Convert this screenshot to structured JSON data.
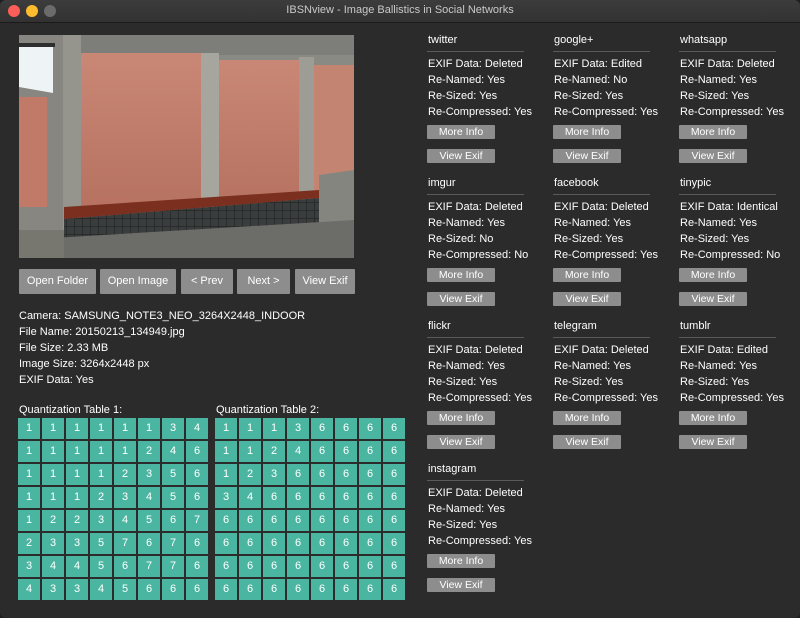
{
  "window": {
    "title": "IBSNview - Image Ballistics in Social Networks"
  },
  "toolbar": {
    "open_folder": "Open Folder",
    "open_image": "Open Image",
    "prev": "< Prev",
    "next": "Next >",
    "view_exif": "View Exif"
  },
  "info": {
    "camera": "Camera: SAMSUNG_NOTE3_NEO_3264X2448_INDOOR",
    "file_name": "File Name: 20150213_134949.jpg",
    "file_size": "File Size: 2.33 MB",
    "image_size": "Image Size: 3264x2448 px",
    "exif_data": "EXIF Data: Yes"
  },
  "quant": {
    "table1": {
      "label": "Quantization Table 1:",
      "rows": [
        [
          1,
          1,
          1,
          1,
          1,
          1,
          3,
          4
        ],
        [
          1,
          1,
          1,
          1,
          1,
          2,
          4,
          6
        ],
        [
          1,
          1,
          1,
          1,
          2,
          3,
          5,
          6
        ],
        [
          1,
          1,
          1,
          2,
          3,
          4,
          5,
          6
        ],
        [
          1,
          2,
          2,
          3,
          4,
          5,
          6,
          7
        ],
        [
          2,
          3,
          3,
          5,
          7,
          6,
          7,
          6
        ],
        [
          3,
          4,
          4,
          5,
          6,
          7,
          7,
          6
        ],
        [
          4,
          3,
          3,
          4,
          5,
          6,
          6,
          6
        ]
      ]
    },
    "table2": {
      "label": "Quantization Table 2:",
      "rows": [
        [
          1,
          1,
          1,
          3,
          6,
          6,
          6,
          6
        ],
        [
          1,
          1,
          2,
          4,
          6,
          6,
          6,
          6
        ],
        [
          1,
          2,
          3,
          6,
          6,
          6,
          6,
          6
        ],
        [
          3,
          4,
          6,
          6,
          6,
          6,
          6,
          6
        ],
        [
          6,
          6,
          6,
          6,
          6,
          6,
          6,
          6
        ],
        [
          6,
          6,
          6,
          6,
          6,
          6,
          6,
          6
        ],
        [
          6,
          6,
          6,
          6,
          6,
          6,
          6,
          6
        ],
        [
          6,
          6,
          6,
          6,
          6,
          6,
          6,
          6
        ]
      ]
    }
  },
  "networks": [
    {
      "name": "twitter",
      "exif": "EXIF Data: Deleted",
      "renamed": "Re-Named: Yes",
      "resized": "Re-Sized: Yes",
      "recompressed": "Re-Compressed: Yes",
      "more_info": "More Info",
      "view_exif": "View Exif"
    },
    {
      "name": "google+",
      "exif": "EXIF Data: Edited",
      "renamed": "Re-Named: No",
      "resized": "Re-Sized: Yes",
      "recompressed": "Re-Compressed: Yes",
      "more_info": "More Info",
      "view_exif": "View Exif"
    },
    {
      "name": "whatsapp",
      "exif": "EXIF Data: Deleted",
      "renamed": "Re-Named: Yes",
      "resized": "Re-Sized: Yes",
      "recompressed": "Re-Compressed: Yes",
      "more_info": "More Info",
      "view_exif": "View Exif"
    },
    {
      "name": "imgur",
      "exif": "EXIF Data: Deleted",
      "renamed": "Re-Named: Yes",
      "resized": "Re-Sized: No",
      "recompressed": "Re-Compressed: No",
      "more_info": "More Info",
      "view_exif": "View Exif"
    },
    {
      "name": "facebook",
      "exif": "EXIF Data: Deleted",
      "renamed": "Re-Named: Yes",
      "resized": "Re-Sized: Yes",
      "recompressed": "Re-Compressed: Yes",
      "more_info": "More Info",
      "view_exif": "View Exif"
    },
    {
      "name": "tinypic",
      "exif": "EXIF Data: Identical",
      "renamed": "Re-Named: Yes",
      "resized": "Re-Sized: Yes",
      "recompressed": "Re-Compressed: No",
      "more_info": "More Info",
      "view_exif": "View Exif"
    },
    {
      "name": "flickr",
      "exif": "EXIF Data: Deleted",
      "renamed": "Re-Named: Yes",
      "resized": "Re-Sized: Yes",
      "recompressed": "Re-Compressed: Yes",
      "more_info": "More Info",
      "view_exif": "View Exif"
    },
    {
      "name": "telegram",
      "exif": "EXIF Data: Deleted",
      "renamed": "Re-Named: Yes",
      "resized": "Re-Sized: Yes",
      "recompressed": "Re-Compressed: Yes",
      "more_info": "More Info",
      "view_exif": "View Exif"
    },
    {
      "name": "tumblr",
      "exif": "EXIF Data: Edited",
      "renamed": "Re-Named: Yes",
      "resized": "Re-Sized: Yes",
      "recompressed": "Re-Compressed: Yes",
      "more_info": "More Info",
      "view_exif": "View Exif"
    },
    {
      "name": "instagram",
      "exif": "EXIF Data: Deleted",
      "renamed": "Re-Named: Yes",
      "resized": "Re-Sized: Yes",
      "recompressed": "Re-Compressed: Yes",
      "more_info": "More Info",
      "view_exif": "View Exif"
    }
  ]
}
